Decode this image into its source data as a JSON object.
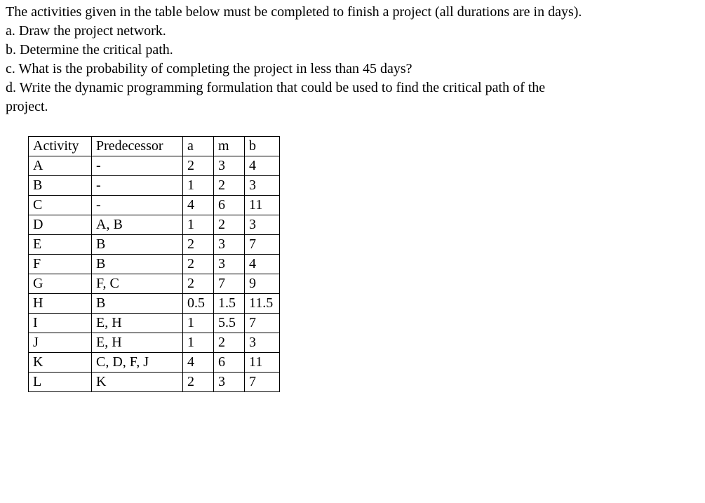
{
  "intro": {
    "line1": "The activities given in the table below must be completed to finish a project (all durations are in days).",
    "line2": "a. Draw the project network.",
    "line3": "b. Determine the critical path.",
    "line4": "c. What is the probability of completing the project in less than 45 days?",
    "line5": "d. Write the dynamic programming formulation that could be used to find the critical path of the",
    "line6": "project."
  },
  "table": {
    "headers": {
      "activity": "Activity",
      "predecessor": "Predecessor",
      "a": "a",
      "m": "m",
      "b": "b"
    },
    "rows": [
      {
        "activity": "A",
        "predecessor": "-",
        "a": "2",
        "m": "3",
        "b": "4"
      },
      {
        "activity": "B",
        "predecessor": "-",
        "a": "1",
        "m": "2",
        "b": "3"
      },
      {
        "activity": "C",
        "predecessor": "-",
        "a": "4",
        "m": "6",
        "b": "11"
      },
      {
        "activity": "D",
        "predecessor": "A, B",
        "a": "1",
        "m": "2",
        "b": "3"
      },
      {
        "activity": "E",
        "predecessor": "B",
        "a": "2",
        "m": "3",
        "b": "7"
      },
      {
        "activity": "F",
        "predecessor": "B",
        "a": "2",
        "m": "3",
        "b": "4"
      },
      {
        "activity": "G",
        "predecessor": "F, C",
        "a": "2",
        "m": "7",
        "b": "9"
      },
      {
        "activity": "H",
        "predecessor": "B",
        "a": "0.5",
        "m": "1.5",
        "b": "11.5"
      },
      {
        "activity": "I",
        "predecessor": "E, H",
        "a": "1",
        "m": "5.5",
        "b": "7"
      },
      {
        "activity": "J",
        "predecessor": "E, H",
        "a": "1",
        "m": "2",
        "b": "3"
      },
      {
        "activity": "K",
        "predecessor": "C, D, F, J",
        "a": "4",
        "m": "6",
        "b": "11"
      },
      {
        "activity": "L",
        "predecessor": "K",
        "a": "2",
        "m": "3",
        "b": "7"
      }
    ]
  }
}
